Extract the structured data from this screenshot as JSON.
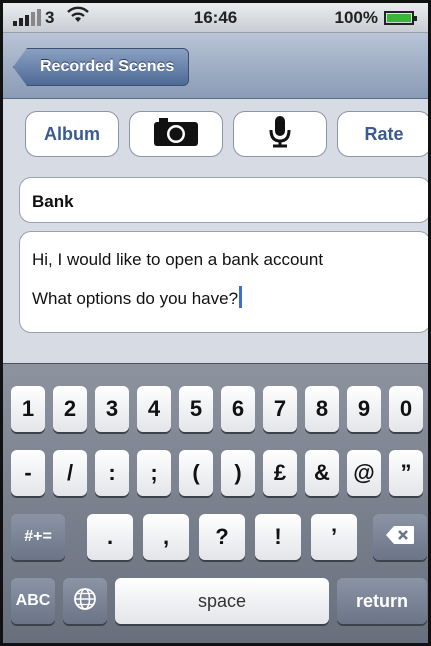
{
  "status_bar": {
    "carrier": "3",
    "time": "16:46",
    "battery": "100%",
    "icons": [
      "signal-icon",
      "wifi-icon",
      "battery-icon"
    ]
  },
  "nav": {
    "back_label": "Recorded Scenes"
  },
  "toolbar": {
    "album_label": "Album",
    "camera_icon": "camera-icon",
    "mic_icon": "microphone-icon",
    "rate_label": "Rate"
  },
  "note": {
    "title": "Bank",
    "body_line1": "Hi, I would like to open a bank account",
    "body_line2": "What options do you have?"
  },
  "keyboard": {
    "row1": [
      "1",
      "2",
      "3",
      "4",
      "5",
      "6",
      "7",
      "8",
      "9",
      "0"
    ],
    "row2": [
      "-",
      "/",
      ":",
      ";",
      "(",
      ")",
      "£",
      "&",
      "@",
      "”"
    ],
    "row3_left": "#+=",
    "row3": [
      ".",
      ",",
      "?",
      "!",
      "’"
    ],
    "abc": "ABC",
    "globe_icon": "globe-icon",
    "space": "space",
    "return": "return",
    "delete_icon": "delete-icon"
  }
}
